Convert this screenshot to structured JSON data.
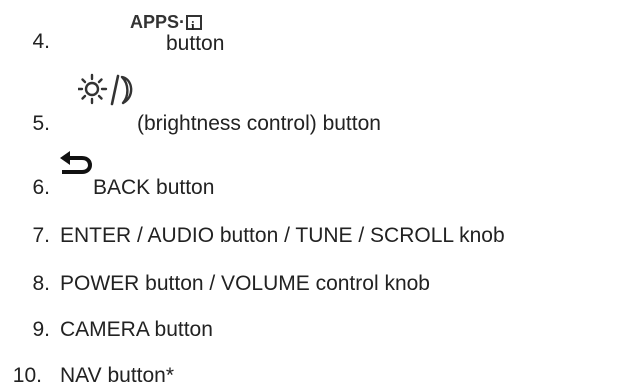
{
  "items": [
    {
      "number": "4.",
      "icon": "apps-info-icon",
      "icon_text": "APPS·",
      "text": "button"
    },
    {
      "number": "5.",
      "icon": "brightness-sun-moon-icon",
      "text": "(brightness control) button"
    },
    {
      "number": "6.",
      "icon": "back-arrow-icon",
      "text": "BACK button"
    },
    {
      "number": "7.",
      "text": "ENTER / AUDIO button / TUNE / SCROLL knob"
    },
    {
      "number": "8.",
      "text": "POWER button / VOLUME control knob"
    },
    {
      "number": "9.",
      "text": "CAMERA button"
    },
    {
      "number": "10.",
      "text": "NAV button*"
    }
  ]
}
